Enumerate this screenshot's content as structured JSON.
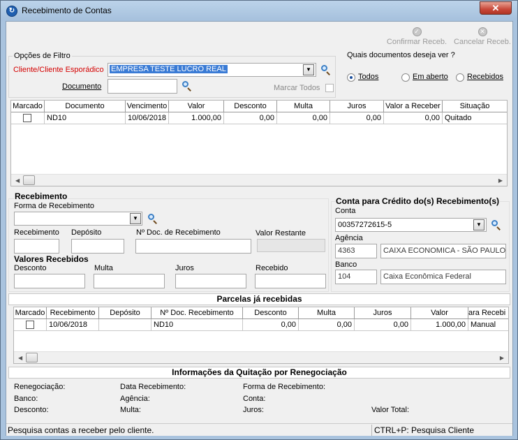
{
  "window": {
    "title": "Recebimento de Contas",
    "close_glyph": "✕"
  },
  "toolbar": {
    "confirm_label": "Confirmar Receb.",
    "cancel_label": "Cancelar Receb."
  },
  "filter": {
    "group_title": "Opções de Filtro",
    "client_label": "Cliente/Cliente Esporádico",
    "client_label_color": "#d40000",
    "client_value": "EMPRESA TESTE LUCRO REAL",
    "document_label": "Documento",
    "document_value": "",
    "mark_all_label": "Marcar Todos"
  },
  "docs_view": {
    "question": "Quais documentos deseja ver ?",
    "options": [
      {
        "label": "Todos",
        "selected": true
      },
      {
        "label": "Em aberto",
        "selected": false
      },
      {
        "label": "Recebidos",
        "selected": false
      }
    ]
  },
  "contas_grid": {
    "columns": [
      "Marcado",
      "Documento",
      "Vencimento",
      "Valor",
      "Desconto",
      "Multa",
      "Juros",
      "Valor a Receber",
      "Situação"
    ],
    "rows": [
      {
        "checked": false,
        "documento": "ND10",
        "vencimento": "10/06/2018",
        "valor": "1.000,00",
        "desconto": "0,00",
        "multa": "0,00",
        "juros": "0,00",
        "valor_receber": "0,00",
        "situacao": "Quitado"
      }
    ]
  },
  "recebimento": {
    "title": "Recebimento",
    "forma_label": "Forma de Recebimento",
    "forma_value": "",
    "recebimento_label": "Recebimento",
    "deposito_label": "Depósito",
    "nro_doc_label": "Nº Doc. de Recebimento",
    "valor_restante_label": "Valor Restante",
    "valores_title": "Valores Recebidos",
    "desconto_label": "Desconto",
    "multa_label": "Multa",
    "juros_label": "Juros",
    "recebido_label": "Recebido"
  },
  "conta_credito": {
    "title": "Conta para Crédito do(s) Recebimento(s)",
    "conta_label": "Conta",
    "conta_value": "00357272615-5",
    "agencia_label": "Agência",
    "agencia_code": "4363",
    "agencia_name": "CAIXA ECONOMICA - SÃO PAULO (",
    "banco_label": "Banco",
    "banco_code": "104",
    "banco_name": "Caixa Econômica Federal"
  },
  "parcelas": {
    "title": "Parcelas já recebidas",
    "columns": [
      "Marcado",
      "Recebimento",
      "Depósito",
      "Nº Doc. Recebimento",
      "Desconto",
      "Multa",
      "Juros",
      "Valor",
      "ara Recebi"
    ],
    "rows": [
      {
        "checked": false,
        "recebimento": "10/06/2018",
        "deposito": "",
        "nro_doc": "ND10",
        "desconto": "0,00",
        "multa": "0,00",
        "juros": "0,00",
        "valor": "1.000,00",
        "forma": "Manual"
      }
    ]
  },
  "quitacao": {
    "title": "Informações da Quitação por Renegociação",
    "renegociacao": "Renegociação:",
    "data_recebimento": "Data Recebimento:",
    "forma_recebimento": "Forma de Recebimento:",
    "banco": "Banco:",
    "agencia": "Agência:",
    "conta": "Conta:",
    "desconto": "Desconto:",
    "multa": "Multa:",
    "juros": "Juros:",
    "valor_total": "Valor Total:"
  },
  "status": {
    "left": "Pesquisa contas a receber pelo cliente.",
    "right": "CTRL+P: Pesquisa Cliente"
  }
}
